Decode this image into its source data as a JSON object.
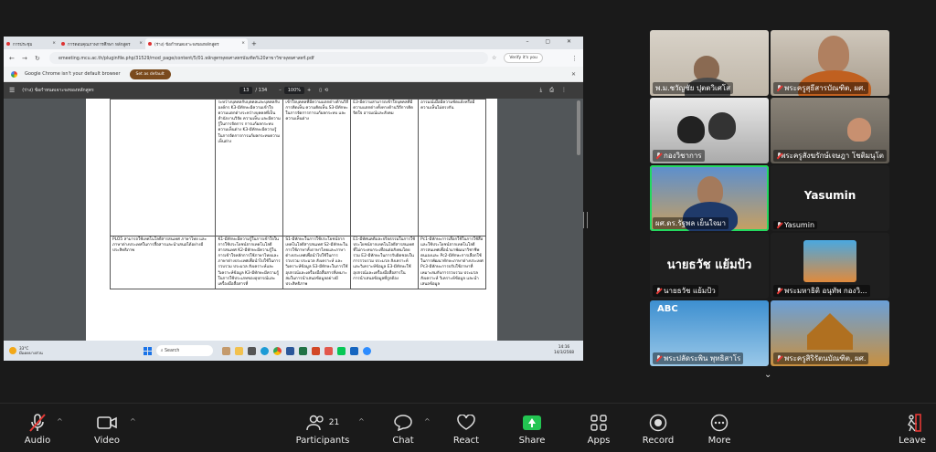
{
  "browser": {
    "tabs": [
      {
        "label": "การประชุม"
      },
      {
        "label": "การตอบคุณภาพการศึกษา หลักสูตร"
      },
      {
        "label": "(ร่าง) ข้อกำหนดเจาะจงของหลักสูตร"
      }
    ],
    "new_tab": "+",
    "url": "emeeting.mcu.ac.th/pluginfile.php/31529/mod_page/content/5/01.หลักสูตรพุทธศาสตรบัณฑิต%20สาขาวิชาพุทธศาสตร์.pdf",
    "verify_label": "Verify it's you",
    "default_browser_msg": "Google Chrome isn't your default browser",
    "set_default_label": "Set as default"
  },
  "pdf": {
    "title": "(ร่าง) ข้อกำหนดเจาะจงของหลักสูตร",
    "page_current": "13",
    "page_total": "/ 134",
    "zoom": "100%",
    "table_rows": [
      {
        "cells": [
          "",
          "ระหว่างบุคคลกับบุคคลและบุคคลกับองค์กร K3-มีทักษะมีความเข้าใจความแตกต่างระหว่างบุคคลที่เป็นสำนักงานวิจัย ความเห็น และมีความรู้ในการจัดการ การแก้ผลกระทบความเห็นต่าง K3-มีทักษะมีความรู้ในการจัดการการแก้ผลกระทบความเห็นต่าง",
          "เข้าใจบุคคลที่มีความแตกต่างด้านวิถีการคิดเห็น ความคิดเห็น S3-มีทักษะในการจัดการการแก้ผลกระทบ และความเห็นต่าง",
          "E3-มีความสามารถเข้าใจบุคคลที่มีความแตกต่างทั้งทางด้านวิถีการคิด จิตใจ อารมณ์และสังคม",
          "อารมณ์เมื่อมีความขัดแย้งหรือมีความเห็นไม่ตรงกัน"
        ]
      },
      {
        "cells": [
          "PLO5 สามารถใช้เทคโนโลยีสารสนเทศ ภาษาไทย และภาษาต่างประเทศในการสื่อสารและนำเสนอได้อย่างมีประสิทธิภาพ",
          "K1-มีทักษะมีความรู้ในการเข้าใจในการใช้ประโยชน์จากเทคโนโลยีสารสนเทศ K2-มีทักษะมีความรู้ในการเข้าใจหลักการใช้ภาษาไทยและภาษาต่างประเทศเพื่อนำไปใช้ในการรวบรวม ประมวล สังเคราะห์และวิเคราะห์ข้อมูล K3-มีทักษะมีความรู้ในการใช้ประเภทของอุปกรณ์และเครื่องมือสื่อสารที่",
          "S1-มีทักษะในการใช้ประโยชน์จากเทคโนโลยีสารสนเทศ S2-มีทักษะในการใช้ภาษาทั้งภาษาไทยและภาษาต่างประเทศเพื่อนำไปใช้ในการรวบรวม ประมวล สังเคราะห์ และวิเคราะห์ข้อมูล S3-มีทักษะในการใช้อุปกรณ์และเครื่องมือสื่อสารที่เหมาะสมในการนำเสนอข้อมูลอย่างมีประสิทธิภาพ",
          "E1-มีทัศนคติและจริยธรรมในการใช้ประโยชน์จากเทคโนโลยีสารสนเทศ ที่ไม่กระทบกระเทือนต่อสังคมโดยรวม E2-มีทักษะในการรับผิดชอบในการรวบรวม ประมวล สังเคราะห์ และวิเคราะห์ข้อมูล E3-มีทักษะใช้อุปกรณ์และเครื่องมือสื่อสารในการนำเสนอข้อมูลที่ถูกต้อง",
          "Pc1-มีทักษะการเลือกใช้ในการใช้สื่อและใช้ประโยชน์จากเทคโนโลยีสารสนเทศเพื่อนำมาพัฒนาวิชาชีพตนเองและ Pc2-มีทักษะการเลือกใช้ในการพัฒนาทักษะภาษาต่างประเทศ Pc3-มีทักษะการปรับใช้ภาษาที่เหมาะสมกับการรวบรวม ประมวล สังเคราะห์ วิเคราะห์ข้อมูล และนำเสนอข้อมูล"
        ]
      }
    ]
  },
  "taskbar": {
    "temp": "33°C",
    "weather": "มีแดดบางส่วน",
    "search_label": "Search",
    "time": "14:16",
    "date": "14/3/2568"
  },
  "participants_tiles": [
    {
      "name": "พ.ม.ชวัญชัย ปุตตวิเศโส",
      "muted": false
    },
    {
      "name": "พระครูสุธีสารบัณฑิต, ผศ.",
      "muted": true
    },
    {
      "name": "กองวิชาการ",
      "muted": true
    },
    {
      "name": "พระครูสังฆรักษ์เจษฎา โชติมนุโต",
      "muted": true
    },
    {
      "name": "ผศ.ดร.รัฐพล เย็นใจมา",
      "muted": false
    },
    {
      "name": "Yasumin",
      "muted": true,
      "display": "Yasumin"
    },
    {
      "name": "นายธวัช แย้มป้ว",
      "muted": true,
      "display": "นายธวัช  แย้มป้ว"
    },
    {
      "name": "พระมหาธิติ อนุทัพ กองวิ...",
      "muted": true
    },
    {
      "name": "พระปลัดระพิน พุทธิสาโร",
      "muted": true
    },
    {
      "name": "พระครูสิริรัตนบัณฑิต, ผศ.",
      "muted": true
    }
  ],
  "tile_badge": "ABC",
  "toolbar": {
    "audio": "Audio",
    "video": "Video",
    "participants": "Participants",
    "participants_count": "21",
    "chat": "Chat",
    "react": "React",
    "share": "Share",
    "apps": "Apps",
    "record": "Record",
    "more": "More",
    "leave": "Leave"
  },
  "colors": {
    "accent_green": "#23c552",
    "speaker_outline": "#23d95f",
    "muted_red": "#e53935"
  }
}
